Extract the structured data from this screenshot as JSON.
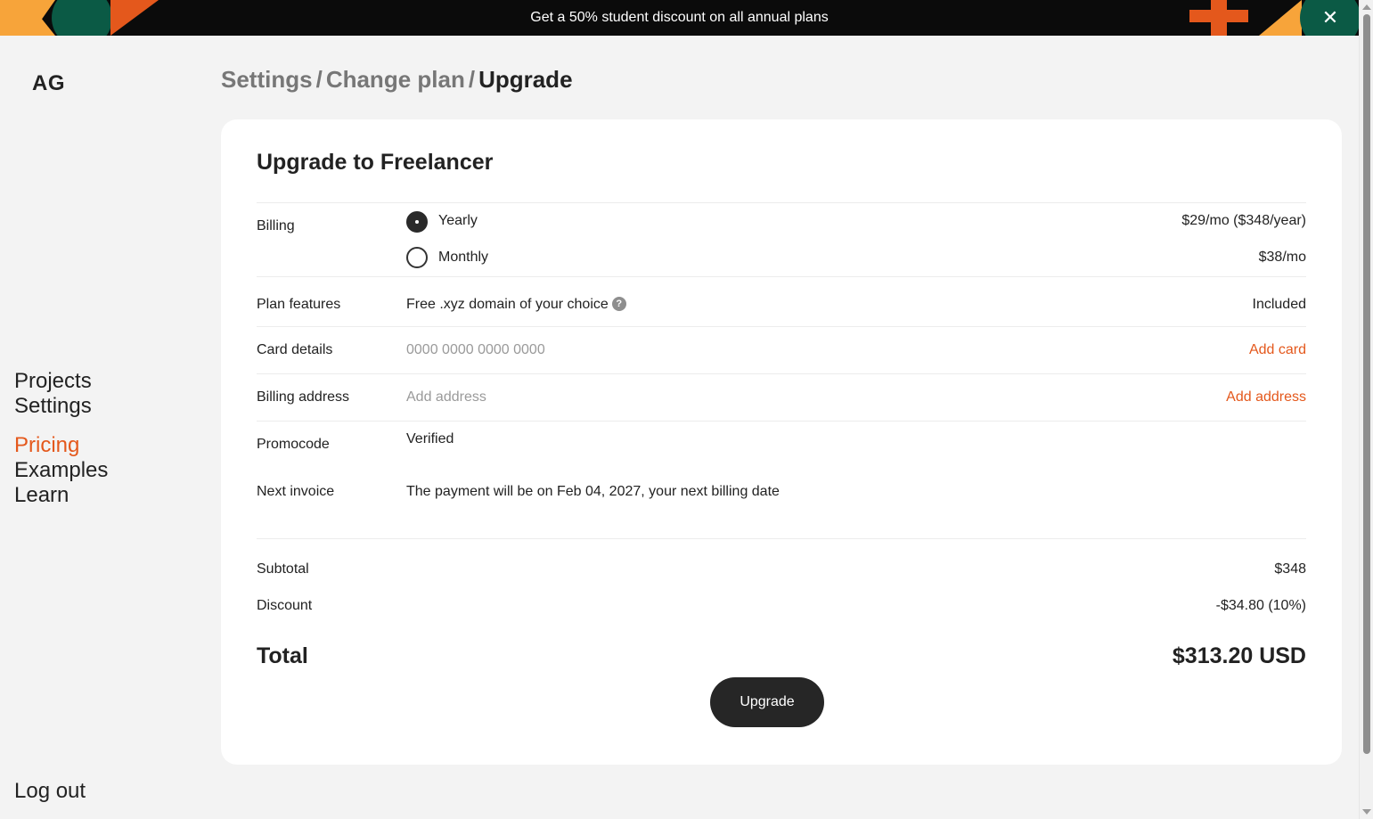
{
  "banner": {
    "text": "Get a 50% student discount on all annual plans",
    "close_label": "✕",
    "colors": {
      "orange": "#e4581c",
      "yellow": "#f7a43a",
      "green": "#0b5a45"
    }
  },
  "sidebar": {
    "logo": "AG",
    "items": [
      {
        "label": "Projects"
      },
      {
        "label": "Settings"
      },
      {
        "label": "Pricing",
        "active": true
      },
      {
        "label": "Examples"
      },
      {
        "label": "Learn"
      }
    ],
    "logout": "Log out"
  },
  "breadcrumb": {
    "items": [
      "Settings",
      "Change plan",
      "Upgrade"
    ],
    "separator": "/"
  },
  "card": {
    "title": "Upgrade to Freelancer",
    "billing": {
      "label": "Billing",
      "options": [
        {
          "label": "Yearly",
          "price": "$29/mo ($348/year)",
          "selected": true
        },
        {
          "label": "Monthly",
          "price": "$38/mo",
          "selected": false
        }
      ]
    },
    "plan_features": {
      "label": "Plan features",
      "value": "Free .xyz domain of your choice",
      "help_icon": "?",
      "status": "Included"
    },
    "card_details": {
      "label": "Card details",
      "placeholder": "0000 0000 0000 0000",
      "action": "Add card"
    },
    "billing_address": {
      "label": "Billing address",
      "placeholder": "Add address",
      "action": "Add address"
    },
    "promocode": {
      "label": "Promocode",
      "value": "Verified"
    },
    "next_invoice": {
      "label": "Next invoice",
      "value": "The payment will be on Feb 04, 2027, your next billing date"
    },
    "subtotal": {
      "label": "Subtotal",
      "value": "$348"
    },
    "discount": {
      "label": "Discount",
      "value": "-$34.80 (10%)"
    },
    "total": {
      "label": "Total",
      "value": "$313.20 USD"
    },
    "upgrade_button": "Upgrade"
  },
  "accent_color": "#e4581c"
}
